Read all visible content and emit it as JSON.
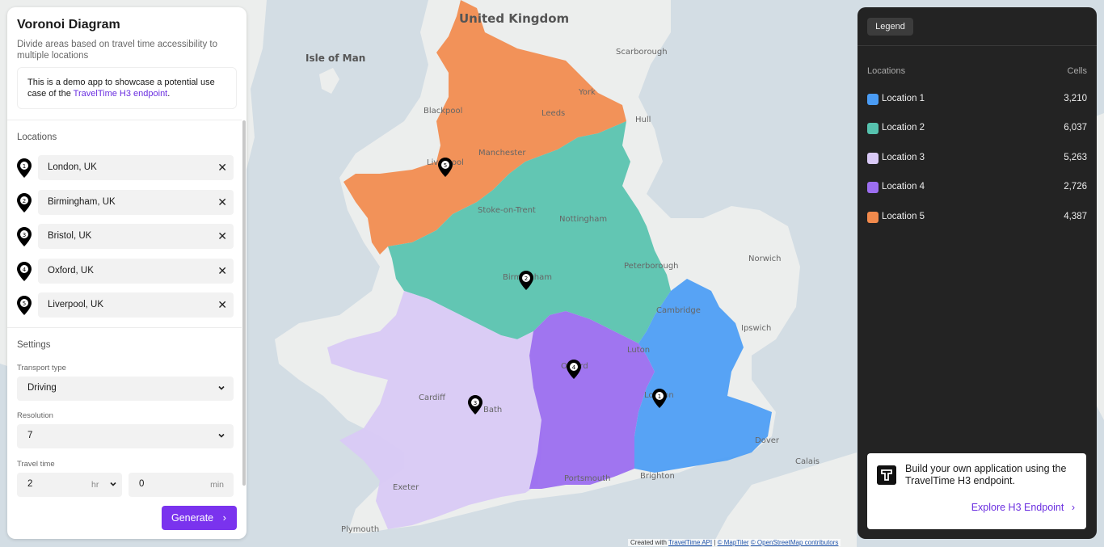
{
  "app": {
    "title": "Voronoi Diagram",
    "subtitle": "Divide areas based on travel time accessibility to multiple locations",
    "note_prefix": "This is a demo app to showcase a potential use case of the ",
    "note_link": "TravelTime H3 endpoint",
    "note_suffix": "."
  },
  "locations": {
    "label": "Locations",
    "items": [
      {
        "num": "1",
        "value": "London, UK"
      },
      {
        "num": "2",
        "value": "Birmingham, UK"
      },
      {
        "num": "3",
        "value": "Bristol, UK"
      },
      {
        "num": "4",
        "value": "Oxford, UK"
      },
      {
        "num": "5",
        "value": "Liverpool, UK"
      }
    ],
    "remove_icon": "close-icon"
  },
  "settings": {
    "label": "Settings",
    "transport_label": "Transport type",
    "transport_value": "Driving",
    "resolution_label": "Resolution",
    "resolution_value": "7",
    "travel_time_label": "Travel time",
    "hours_value": "2",
    "hours_unit": "hr",
    "minutes_value": "0",
    "minutes_unit": "min"
  },
  "generate_label": "Generate",
  "legend": {
    "tab": "Legend",
    "col_locations": "Locations",
    "col_cells": "Cells",
    "items": [
      {
        "name": "Location 1",
        "cells": "3,210",
        "color": "#4a9cf5"
      },
      {
        "name": "Location 2",
        "cells": "6,037",
        "color": "#56c2ae"
      },
      {
        "name": "Location 3",
        "cells": "5,263",
        "color": "#d9c9f6"
      },
      {
        "name": "Location 4",
        "cells": "2,726",
        "color": "#9c6ef0"
      },
      {
        "name": "Location 5",
        "cells": "4,387",
        "color": "#f28a4c"
      }
    ]
  },
  "promo": {
    "text": "Build your own application using the TravelTime H3 endpoint.",
    "link": "Explore H3 Endpoint"
  },
  "map": {
    "places": [
      {
        "name": "United Kingdom"
      },
      {
        "name": "Isle of Man"
      },
      {
        "name": "Scarborough"
      },
      {
        "name": "York"
      },
      {
        "name": "Leeds"
      },
      {
        "name": "Blackpool"
      },
      {
        "name": "Hull"
      },
      {
        "name": "Manchester"
      },
      {
        "name": "Liverpool"
      },
      {
        "name": "Stoke-on-Trent"
      },
      {
        "name": "Nottingham"
      },
      {
        "name": "Peterborough"
      },
      {
        "name": "Norwich"
      },
      {
        "name": "Birmingham"
      },
      {
        "name": "Cambridge"
      },
      {
        "name": "Ipswich"
      },
      {
        "name": "Luton"
      },
      {
        "name": "Oxford"
      },
      {
        "name": "London"
      },
      {
        "name": "Cardiff"
      },
      {
        "name": "Bath"
      },
      {
        "name": "Dover"
      },
      {
        "name": "Calais"
      },
      {
        "name": "Exeter"
      },
      {
        "name": "Portsmouth"
      },
      {
        "name": "Brighton"
      },
      {
        "name": "Plymouth"
      }
    ],
    "attribution_prefix": "Created with ",
    "attribution_links": [
      "TravelTime API",
      "© MapTiler",
      "© OpenStreetMap contributors"
    ],
    "attribution_sep": " | "
  }
}
